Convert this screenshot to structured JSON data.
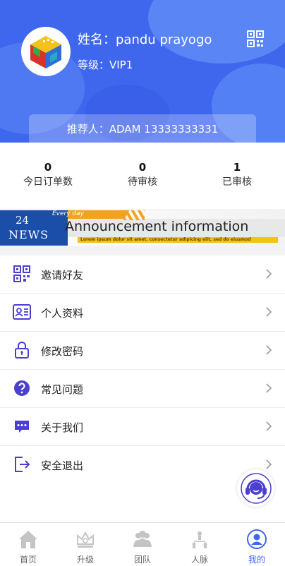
{
  "profile": {
    "name": "姓名：pandu prayogo",
    "level": "等级：VIP1",
    "referrer": "推荐人：ADAM  13333333331"
  },
  "stats": [
    {
      "value": "0",
      "label": "今日订单数"
    },
    {
      "value": "0",
      "label": "待审核"
    },
    {
      "value": "1",
      "label": "已审核"
    }
  ],
  "banner": {
    "number": "24",
    "news": "NEWS",
    "every_day": "Every day",
    "title": "Announcement information",
    "subtitle": "Lorem ipsum dolor sit amet, consectetur adipicing elit, sed do eiusmod"
  },
  "menu": [
    {
      "label": "邀请好友",
      "icon": "qr-code-icon"
    },
    {
      "label": "个人资料",
      "icon": "id-card-icon"
    },
    {
      "label": "修改密码",
      "icon": "lock-icon"
    },
    {
      "label": "常见问题",
      "icon": "question-icon"
    },
    {
      "label": "关于我们",
      "icon": "chat-dots-icon"
    },
    {
      "label": "安全退出",
      "icon": "logout-icon"
    }
  ],
  "tabs": [
    {
      "label": "首页",
      "icon": "home-icon",
      "active": false
    },
    {
      "label": "升级",
      "icon": "crown-icon",
      "active": false
    },
    {
      "label": "团队",
      "icon": "team-icon",
      "active": false
    },
    {
      "label": "人脉",
      "icon": "network-icon",
      "active": false
    },
    {
      "label": "我的",
      "icon": "user-icon",
      "active": true
    }
  ],
  "colors": {
    "brand": "#3f67ee",
    "icon_purple": "#4b3fcf",
    "tab_inactive": "#c4c4c4"
  }
}
